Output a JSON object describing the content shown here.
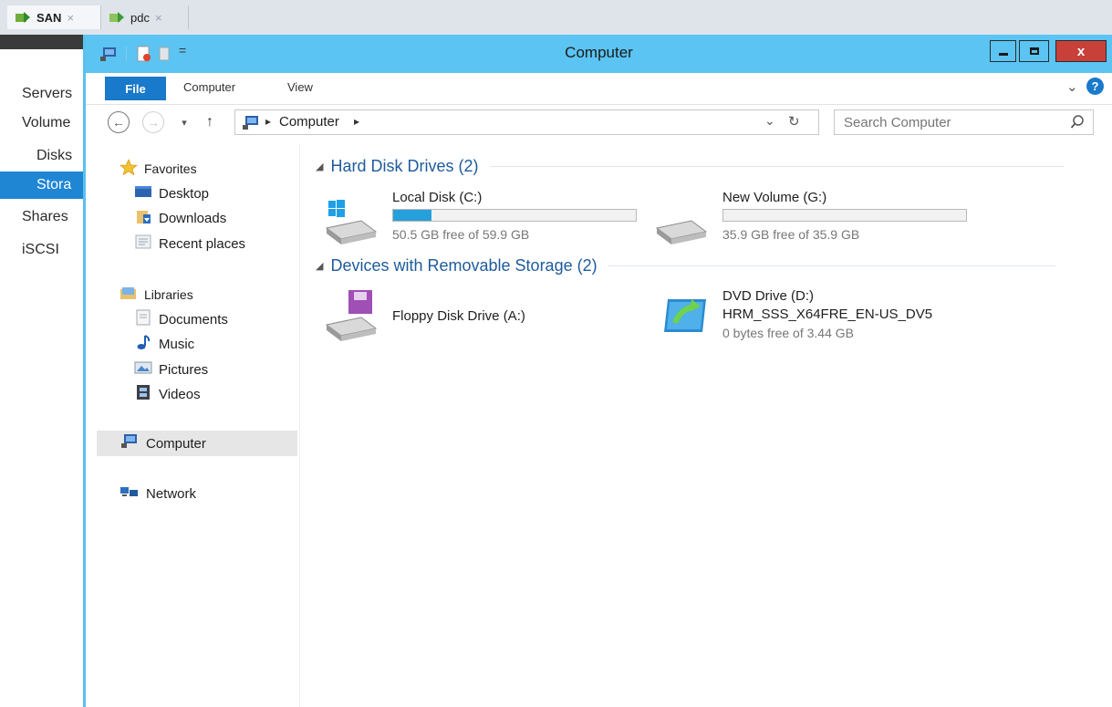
{
  "vm_tabs": [
    {
      "label": "SAN",
      "close": "×",
      "active": true
    },
    {
      "label": "pdc",
      "close": "×",
      "active": false
    }
  ],
  "server_manager": {
    "items": [
      {
        "label": "Servers"
      },
      {
        "label": "Volume"
      },
      {
        "label": "Disks"
      },
      {
        "label": "Stora",
        "selected": true
      },
      {
        "label": "Shares"
      },
      {
        "label": "iSCSI"
      }
    ]
  },
  "window": {
    "title": "Computer",
    "controls": {
      "minimize": "–",
      "maximize": "□",
      "close": "x"
    },
    "qat_dropdown": "="
  },
  "ribbon": {
    "tabs": [
      "File",
      "Computer",
      "View"
    ],
    "expand": "⌄",
    "help": "?"
  },
  "address_bar": {
    "sep1": "▸",
    "location": "Computer",
    "sep2": "▸",
    "dropdown": "⌄",
    "refresh": "↻"
  },
  "nav": {
    "back": "⊖",
    "forward": "⊖",
    "recent": "▾",
    "up": "↑"
  },
  "search": {
    "placeholder": "Search Computer",
    "icon": "search-icon"
  },
  "nav_pane": {
    "favorites": {
      "label": "Favorites",
      "items": [
        "Desktop",
        "Downloads",
        "Recent places"
      ]
    },
    "libraries": {
      "label": "Libraries",
      "items": [
        "Documents",
        "Music",
        "Pictures",
        "Videos"
      ]
    },
    "computer": "Computer",
    "network": "Network"
  },
  "groups": {
    "hard_disks": {
      "label": "Hard Disk Drives (2)",
      "tri": "◢"
    },
    "removable": {
      "label": "Devices with Removable Storage (2)",
      "tri": "◢"
    }
  },
  "drives": {
    "c": {
      "name": "Local Disk (C:)",
      "free": "50.5 GB free of 59.9 GB",
      "used_fraction": 0.157
    },
    "g": {
      "name": "New Volume (G:)",
      "free": "35.9 GB free of 35.9 GB",
      "used_fraction": 0.0
    },
    "a": {
      "name": "Floppy Disk Drive (A:)"
    },
    "d": {
      "name": "DVD Drive (D:)",
      "label": "HRM_SSS_X64FRE_EN-US_DV5",
      "free": "0 bytes free of 3.44 GB"
    }
  },
  "colors": {
    "titlebar": "#5bc4f2",
    "file_tab": "#1979ca",
    "selection": "#1f86d4",
    "usage_bar": "#26a0da"
  }
}
